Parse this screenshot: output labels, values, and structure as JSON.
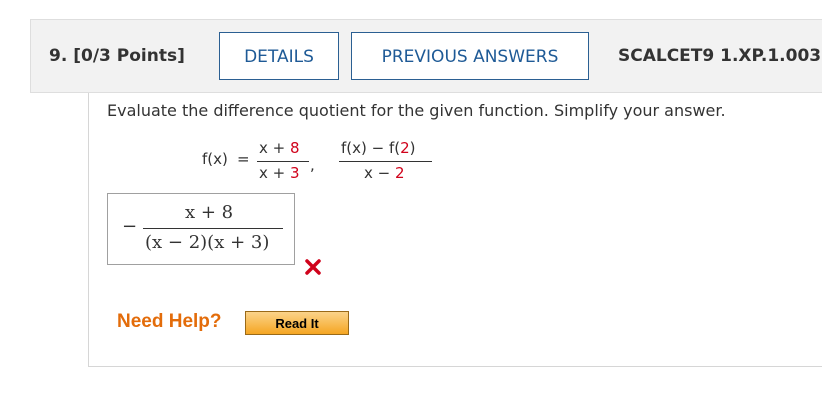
{
  "question": {
    "number": "9.",
    "points": "[0/3 Points]",
    "details_label": "DETAILS",
    "previous_answers_label": "PREVIOUS ANSWERS",
    "code": "SCALCET9 1.XP.1.003."
  },
  "prompt": "Evaluate the difference quotient for the given function. Simplify your answer.",
  "function": {
    "label": "f(x)",
    "equals": "=",
    "num_var": "x + ",
    "num_const": "8",
    "den_var": "x + ",
    "den_const": "3",
    "comma": ","
  },
  "quotient": {
    "num_left": "f(x) − f(",
    "num_arg": "2",
    "num_right": ")",
    "den_left": "x − ",
    "den_const": "2"
  },
  "answer": {
    "sign": "−",
    "numerator": "x + 8",
    "denominator": "(x − 2)(x + 3)",
    "status": "incorrect"
  },
  "colors": {
    "accent": "#1e5a96",
    "highlight": "#d0021b",
    "help": "#e36c0a",
    "readit": "#f5a623"
  },
  "help": {
    "label": "Need Help?",
    "read_it_label": "Read It"
  }
}
